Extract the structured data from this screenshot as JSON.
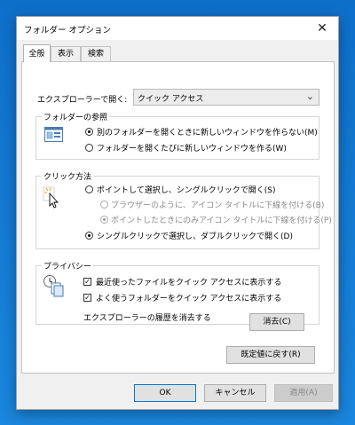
{
  "window": {
    "title": "フォルダー オプション",
    "close_glyph": "✕"
  },
  "tabs": [
    {
      "label": "全般",
      "active": true
    },
    {
      "label": "表示",
      "active": false
    },
    {
      "label": "検索",
      "active": false
    }
  ],
  "general": {
    "explorer_open_label": "エクスプローラーで開く:",
    "explorer_open_value": "クイック アクセス",
    "browse_folders": {
      "title": "フォルダーの参照",
      "icon": "folder-windows-icon",
      "options": [
        {
          "label": "別のフォルダーを開くときに新しいウィンドウを作らない(M)",
          "selected": true
        },
        {
          "label": "フォルダーを開くたびに新しいウィンドウを作る(W)",
          "selected": false
        }
      ]
    },
    "click_items": {
      "title": "クリック方法",
      "icon": "pointer-cursor-icon",
      "single_click": {
        "label": "ポイントして選択し、シングルクリックで開く(S)",
        "selected": false
      },
      "underline_browser": {
        "label": "ブラウザーのように、アイコン タイトルに下線を付ける(B)",
        "selected": false,
        "disabled": true
      },
      "underline_point": {
        "label": "ポイントしたときにのみアイコン タイトルに下線を付ける(P)",
        "selected": true,
        "disabled": true
      },
      "double_click": {
        "label": "シングルクリックで選択し、ダブルクリックで開く(D)",
        "selected": true
      }
    },
    "privacy": {
      "title": "プライバシー",
      "icon": "clock-files-icon",
      "show_recent": {
        "label": "最近使ったファイルをクイック アクセスに表示する",
        "checked": true
      },
      "show_frequent": {
        "label": "よく使うフォルダーをクイック アクセスに表示する",
        "checked": true
      },
      "clear_label": "エクスプローラーの履歴を消去する",
      "clear_button": "消去(C)"
    },
    "restore_defaults": "既定値に戻す(R)"
  },
  "footer": {
    "ok": "OK",
    "cancel": "キャンセル",
    "apply": "適用(A)"
  },
  "colors": {
    "accent": "#0078d7",
    "desktop": "#1a7fd6"
  }
}
